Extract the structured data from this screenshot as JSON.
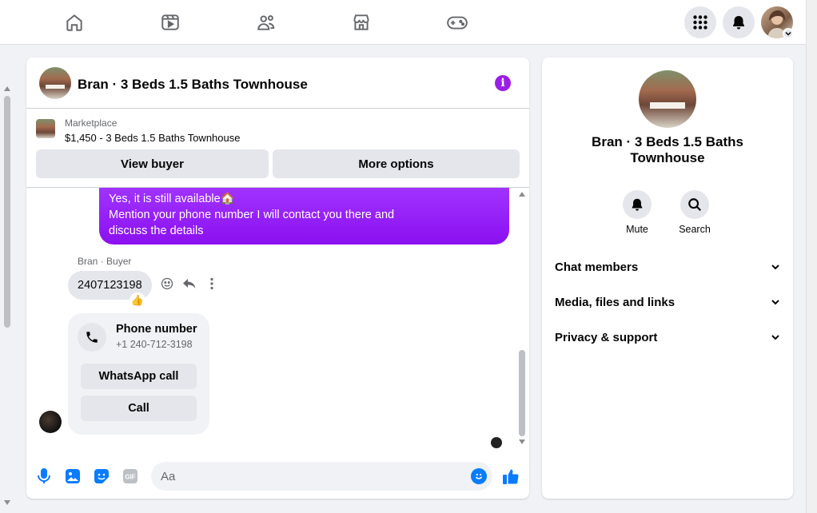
{
  "nav": {
    "icons": [
      "home-icon",
      "watch-icon",
      "groups-icon",
      "marketplace-icon",
      "gaming-icon"
    ],
    "right_icons": [
      "menu-grid-icon",
      "notifications-icon"
    ]
  },
  "chat": {
    "title": "Bran · 3 Beds 1.5 Baths Townhouse",
    "listing": {
      "label": "Marketplace",
      "price_title": "$1,450 - 3 Beds 1.5 Baths Townhouse"
    },
    "buttons": {
      "view_buyer": "View buyer",
      "more_options": "More options"
    },
    "messages": {
      "outgoing_lines": [
        "Yes, it is still available🏠",
        "Mention your phone number I will contact you there and",
        "discuss the details"
      ],
      "sender_label": "Bran · Buyer",
      "incoming_text": "2407123198",
      "reaction": "👍"
    },
    "contact_card": {
      "title": "Phone number",
      "number": "+1 240-712-3198",
      "whatsapp_label": "WhatsApp call",
      "call_label": "Call"
    },
    "composer": {
      "placeholder": "Aa"
    }
  },
  "side": {
    "title": "Bran · 3 Beds 1.5 Baths Townhouse",
    "actions": {
      "mute": "Mute",
      "search": "Search"
    },
    "sections": [
      "Chat members",
      "Media, files and links",
      "Privacy & support"
    ]
  },
  "colors": {
    "accent": "#9b1de8",
    "messenger_blue": "#0a7cff"
  }
}
